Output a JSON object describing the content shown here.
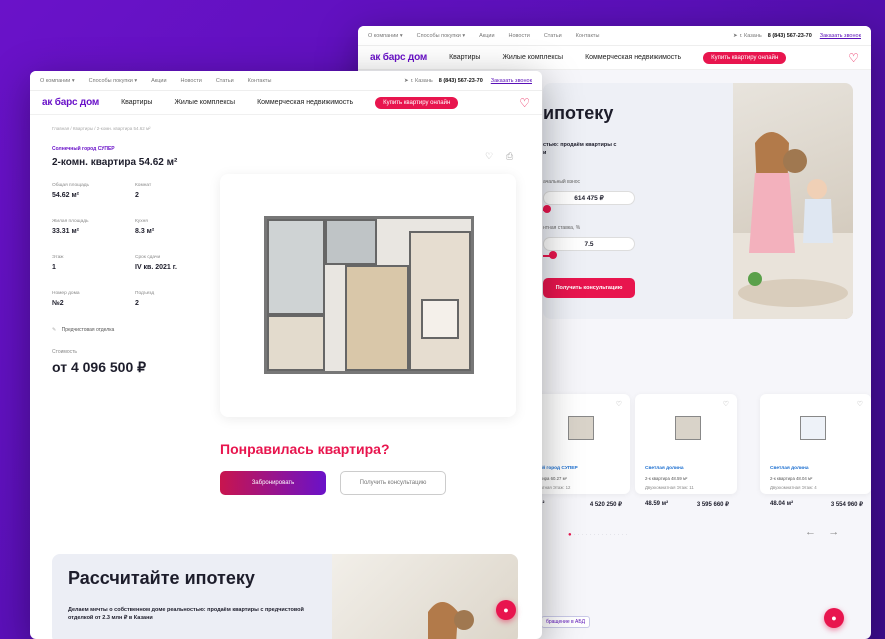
{
  "topbar": {
    "items": [
      "О компании ▾",
      "Способы покупки ▾",
      "Акции",
      "Новости",
      "Статьи",
      "Контакты"
    ],
    "city": "г. Казань",
    "phone": "8 (843) 567-23-70",
    "callback": "Заказать звонок"
  },
  "nav": {
    "logo": "ак барс дом",
    "links": [
      "Квартиры",
      "Жилые комплексы",
      "Коммерческая недвижимость"
    ],
    "online_button": "Купить квартиру онлайн"
  },
  "apartment": {
    "breadcrumb": "Главная / Квартиры / 2-комн. квартира 54.62 м²",
    "complex": "Солнечный город СУПЕР",
    "title": "2-комн. квартира 54.62 м²",
    "params": [
      {
        "label": "Общая площадь",
        "value": "54.62 м²"
      },
      {
        "label": "Комнат",
        "value": "2"
      },
      {
        "label": "Жилая площадь",
        "value": "33.31 м²"
      },
      {
        "label": "Кухня",
        "value": "8.3 м²"
      },
      {
        "label": "Этаж",
        "value": "1"
      },
      {
        "label": "Срок сдачи",
        "value": "IV кв. 2021 г."
      },
      {
        "label": "Номер дома",
        "value": "№2"
      },
      {
        "label": "Подъезд",
        "value": "2"
      }
    ],
    "finish": "Предчистовая отделка",
    "price_label": "Стоимость",
    "price": "от 4 096 500 ₽"
  },
  "cta": {
    "question": "Понравилась квартира?",
    "book": "Забронировать",
    "consult": "Получить консультацию"
  },
  "mortgage": {
    "title": "Рассчитайте ипотеку",
    "text": "Делаем мечты о собственном доме реальностью: продаём квартиры с предчистовой отделкой от 2.3 млн ₽ в Казани"
  },
  "hero": {
    "title": "ипотеку",
    "subtitle": "стью: продаём квартиры с\nи",
    "down_label": "ачальный взнос",
    "down_value": "614 475 ₽",
    "rate_label": "нтная ставка, %",
    "rate_value": "7.5",
    "button": "Получить консультацию"
  },
  "cards": [
    {
      "complex": "ый город СУПЕР",
      "desc": "ртира 60.27 м²",
      "type": "натная    Этаж: 12",
      "area": "м²",
      "price": "4 520 250 ₽"
    },
    {
      "complex": "Светлая долина",
      "desc": "2-к квартира 48.59 м²",
      "type": "Двухкомнатная    Этаж: 11",
      "area": "48.59 м²",
      "price": "3 595 660 ₽"
    },
    {
      "complex": "Светлая долина",
      "desc": "2-к квартира 48.04 м²",
      "type": "Двухкомнатная    Этаж: 4",
      "area": "48.04 м²",
      "price": "3 554 960 ₽"
    }
  ],
  "appeal": "бращение в АБД",
  "colors": {
    "brand": "#6a12c9",
    "accent": "#e8154e"
  }
}
